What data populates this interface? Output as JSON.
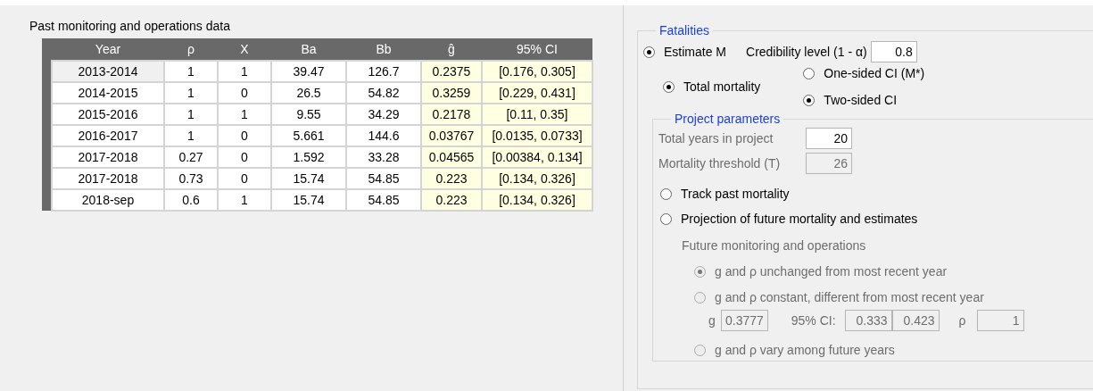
{
  "left_panel": {
    "title": "Past monitoring and operations data",
    "table": {
      "columns": [
        "Year",
        "ρ",
        "X",
        "Ba",
        "Bb",
        "ĝ",
        "95% CI"
      ],
      "rows": [
        {
          "selected": true,
          "cells": [
            "2013-2014",
            "1",
            "1",
            "39.47",
            "126.7",
            "0.2375",
            "[0.176, 0.305]"
          ]
        },
        {
          "selected": false,
          "cells": [
            "2014-2015",
            "1",
            "0",
            "26.5",
            "54.82",
            "0.3259",
            "[0.229, 0.431]"
          ]
        },
        {
          "selected": false,
          "cells": [
            "2015-2016",
            "1",
            "1",
            "9.55",
            "34.29",
            "0.2178",
            "[0.11, 0.35]"
          ]
        },
        {
          "selected": false,
          "cells": [
            "2016-2017",
            "1",
            "0",
            "5.661",
            "144.6",
            "0.03767",
            "[0.0135, 0.0733]"
          ]
        },
        {
          "selected": false,
          "cells": [
            "2017-2018",
            "0.27",
            "0",
            "1.592",
            "33.28",
            "0.04565",
            "[0.00384, 0.134]"
          ]
        },
        {
          "selected": false,
          "cells": [
            "2017-2018",
            "0.73",
            "0",
            "15.74",
            "54.85",
            "0.223",
            "[0.134, 0.326]"
          ]
        },
        {
          "selected": false,
          "cells": [
            "2018-sep",
            "0.6",
            "1",
            "15.74",
            "54.85",
            "0.223",
            "[0.134, 0.326]"
          ]
        }
      ]
    }
  },
  "fatalities": {
    "title": "Fatalities",
    "estimate": {
      "label": "Estimate M",
      "selected": true
    },
    "credibility": {
      "label": "Credibility level (1 - α)",
      "value": "0.8"
    },
    "total": {
      "label": "Total mortality",
      "selected": true
    },
    "ci_options": [
      {
        "label": "One-sided CI (M*)",
        "selected": false
      },
      {
        "label": "Two-sided CI",
        "selected": true
      }
    ],
    "project": {
      "title": "Project parameters",
      "fields": [
        {
          "label": "Total years in project",
          "value": "20",
          "disabled": false
        },
        {
          "label": "Mortality threshold (T)",
          "value": "26",
          "disabled": true
        }
      ],
      "modes": [
        {
          "label": "Track past mortality",
          "selected": false
        },
        {
          "label": "Projection of future mortality and estimates",
          "selected": false
        }
      ],
      "future": {
        "title": "Future monitoring and operations",
        "disabled": true,
        "options": [
          {
            "kind": "radio",
            "label": "g and ρ unchanged from most recent year",
            "selected": true
          },
          {
            "kind": "radio",
            "label": "g and ρ constant, different from most recent year",
            "selected": false
          },
          {
            "kind": "params",
            "g_label": "g",
            "g": "0.3777",
            "ci_label": "95% CI:",
            "ci_low": "0.333",
            "ci_high": "0.423",
            "rho_label": "ρ",
            "rho": "1"
          },
          {
            "kind": "radio",
            "label": "g and ρ vary among future years",
            "selected": false
          }
        ]
      }
    }
  }
}
